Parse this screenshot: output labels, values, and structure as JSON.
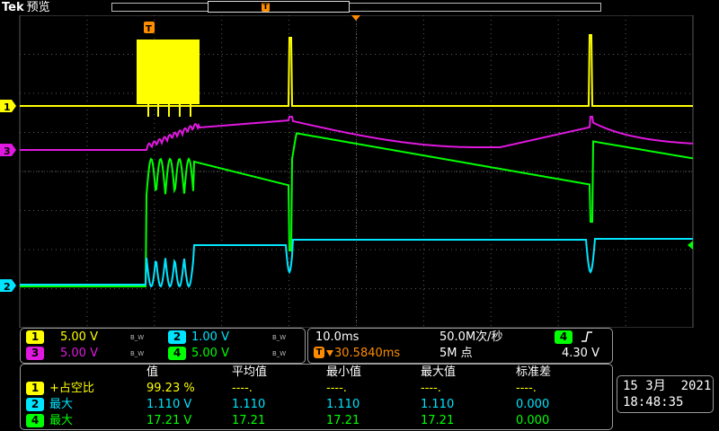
{
  "topbar": {
    "brand": "Tek",
    "mode": "预览",
    "trigger_marker": "T"
  },
  "colors": {
    "ch1": "#ffff00",
    "ch2": "#00e5ff",
    "ch3": "#e018e0",
    "ch4": "#00ff00",
    "trigger_marker": "#ff8c00",
    "grid": "#5a5a5a"
  },
  "markers": {
    "ch1": "1",
    "ch2": "2",
    "ch3": "3",
    "trigger": "T"
  },
  "vertical": {
    "ch1": {
      "badge": "1",
      "scale": "5.00 V",
      "bw": "B_W"
    },
    "ch2": {
      "badge": "2",
      "scale": "1.00 V",
      "bw": "B_W"
    },
    "ch3": {
      "badge": "3",
      "scale": "5.00 V",
      "bw": "B_W"
    },
    "ch4": {
      "badge": "4",
      "scale": "5.00 V",
      "bw": "B_W"
    }
  },
  "horizontal": {
    "timebase": "10.0ms",
    "sample_rate": "50.0M次/秒",
    "trigger_position": "30.5840ms",
    "record_length": "5M 点",
    "trigger_source": "4",
    "trigger_level": "4.30 V",
    "trigger_icon": "rising-edge-icon"
  },
  "measurements": {
    "headers": [
      "值",
      "平均值",
      "最小值",
      "最大值",
      "标准差"
    ],
    "rows": [
      {
        "ch": "1",
        "name": "+占空比",
        "value": "99.23 %",
        "mean": "----.",
        "min": "----.",
        "max": "----.",
        "std": "----."
      },
      {
        "ch": "2",
        "name": "最大",
        "value": "1.110 V",
        "mean": "1.110",
        "min": "1.110",
        "max": "1.110",
        "std": "0.000"
      },
      {
        "ch": "4",
        "name": "最大",
        "value": "17.21 V",
        "mean": "17.21",
        "min": "17.21",
        "max": "17.21",
        "std": "0.000"
      }
    ]
  },
  "datetime": {
    "date": "15 3月  2021",
    "time": "18:48:35"
  }
}
